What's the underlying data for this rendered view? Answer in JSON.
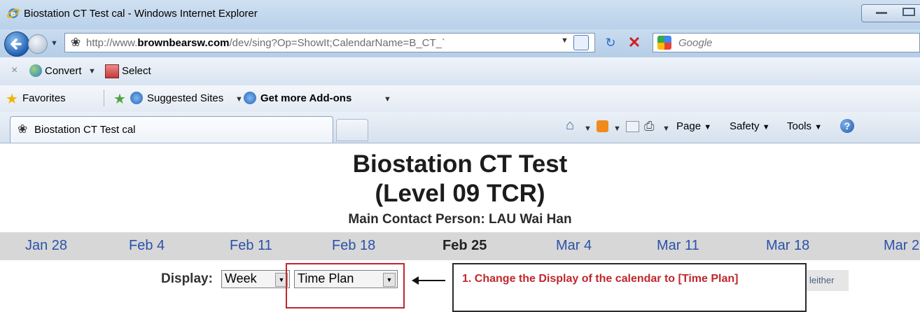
{
  "window": {
    "title": "Biostation CT Test cal - Windows Internet Explorer"
  },
  "address_bar": {
    "url_prefix": "http://www.",
    "url_domain": "brownbearsw.com",
    "url_rest": "/dev/sing?Op=ShowIt;CalendarName=B_CT_`"
  },
  "search": {
    "placeholder": "Google"
  },
  "command_bar": {
    "convert_label": "Convert",
    "select_label": "Select"
  },
  "favorites_bar": {
    "favorites_label": "Favorites",
    "suggested_label": "Suggested Sites",
    "addons_label": "Get more Add-ons"
  },
  "tab": {
    "label": "Biostation CT Test cal"
  },
  "toolbar": {
    "page_label": "Page",
    "safety_label": "Safety",
    "tools_label": "Tools"
  },
  "calendar": {
    "title": "Biostation CT Test",
    "subtitle": "(Level 09 TCR)",
    "contact": "Main Contact Person: LAU Wai Han",
    "weeks": [
      "Jan 28",
      "Feb 4",
      "Feb 11",
      "Feb 18",
      "Feb 25",
      "Mar 4",
      "Mar 11",
      "Mar 18",
      "Mar 2"
    ],
    "current_week_index": 4,
    "display_label": "Display:",
    "display_value": "Week",
    "view_value": "Time Plan",
    "neither_label": "leither"
  },
  "annotation": {
    "callout_text": "1. Change the Display of the calendar to [Time Plan]",
    "highlight_color": "#c0272d"
  }
}
